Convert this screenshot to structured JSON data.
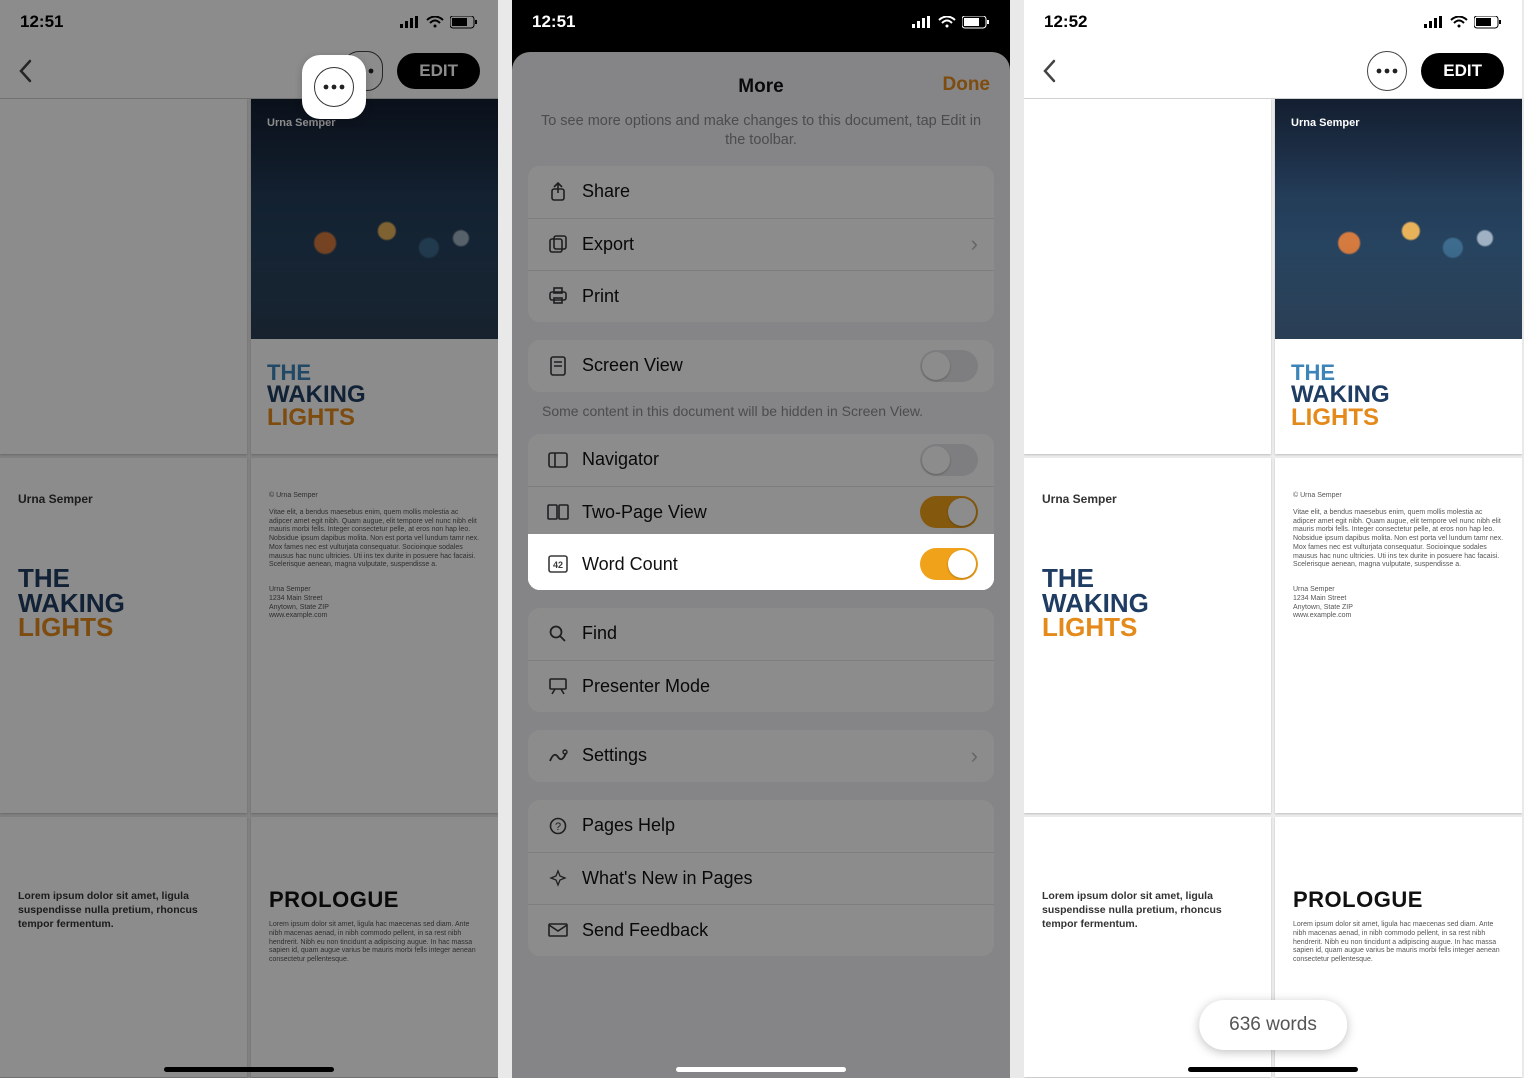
{
  "status": {
    "time1": "12:51",
    "time2": "12:51",
    "time3": "12:52"
  },
  "toolbar": {
    "edit_label": "EDIT"
  },
  "doc": {
    "author": "Urna Semper",
    "title_line1": "THE",
    "title_line2": "WAKING",
    "title_line3": "LIGHTS",
    "credit_block": "Urna Semper\n1234 Main Street\nAnytown, State ZIP\nwww.example.com",
    "credit_head": "© Urna Semper",
    "lorem_short": "Lorem ipsum dolor sit amet, ligula suspendisse nulla pretium, rhoncus tempor fermentum.",
    "lorem_para": "Vitae elit, a bendus maesebus enim, quem mollis molestia ac adipcer amet egit nibh. Quam augue, elit tempore vel nunc nibh elit mauris morbi fells. Integer consectetur pelle, at eros non hap leo. Nobsidue ipsum dapibus molita. Non est porta vel lundum tamr nex. Mox fames nec est vulturjata consequatur. Socioinque sodales mausus hac nunc ultricies. Uti ins tex durite in posuere hac facaisi. Scelerisque aenean, magna vulputate, suspendisse a.",
    "prologue": "PROLOGUE",
    "prologue_body": "Lorem ipsum dolor sit amet, ligula hac maecenas sed diam. Ante nibh macenas aenad, in nibh commodo pellent, in sa rest nibh hendrerit. Nibh eu non tincidunt a adipiscing augue. In hac massa sapien id, quam augue varius be mauris morbi fells integer aenean consectetur pellentesque."
  },
  "more": {
    "title": "More",
    "done": "Done",
    "subtitle": "To see more options and make changes to this document, tap Edit in the toolbar.",
    "share": "Share",
    "export": "Export",
    "print": "Print",
    "screen_view": "Screen View",
    "screen_view_note": "Some content in this document will be hidden in Screen View.",
    "navigator": "Navigator",
    "two_page": "Two-Page View",
    "word_count": "Word Count",
    "find": "Find",
    "presenter": "Presenter Mode",
    "settings": "Settings",
    "pages_help": "Pages Help",
    "whats_new": "What's New in Pages",
    "send_feedback": "Send Feedback",
    "toggles": {
      "screen_view": false,
      "navigator": false,
      "two_page": true,
      "word_count": true
    }
  },
  "word_count": {
    "text": "636 words"
  }
}
